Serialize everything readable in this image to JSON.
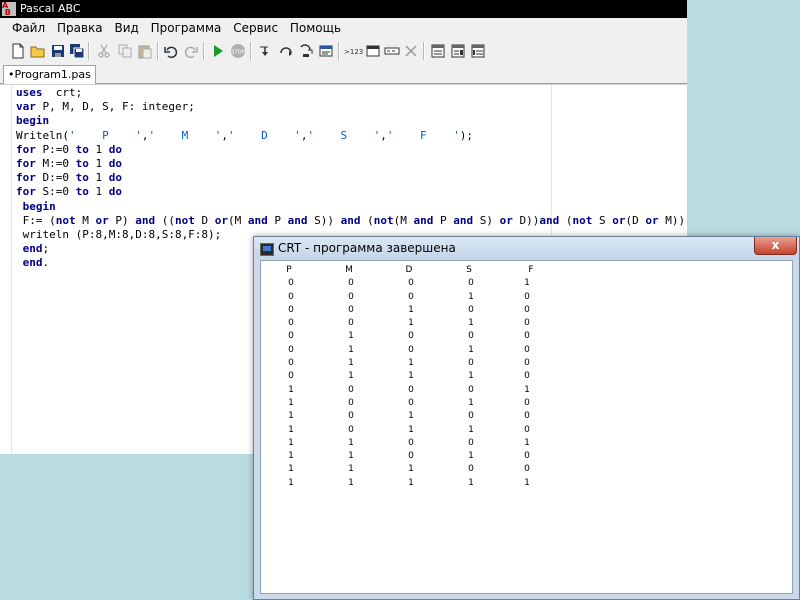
{
  "window": {
    "title": "Pascal ABC"
  },
  "menu": [
    "Файл",
    "Правка",
    "Вид",
    "Программа",
    "Сервис",
    "Помощь"
  ],
  "toolbar": [
    "new-file-icon",
    "open-folder-icon",
    "save-icon",
    "save-all-icon",
    "cut-icon",
    "copy-icon",
    "paste-icon",
    "undo-icon",
    "redo-icon",
    "run-icon",
    "stop-icon",
    "step-into-icon",
    "step-over-icon",
    "run-to-cursor-icon",
    "watch-icon",
    "format-code-icon",
    "window-icon",
    "output-icon",
    "close-icon",
    "debug-window-1-icon",
    "debug-window-2-icon",
    "debug-window-3-icon"
  ],
  "tab": {
    "label": "•Program1.pas"
  },
  "code_lines": [
    "uses  crt;",
    "var P, M, D, S, F: integer;",
    "begin",
    "Writeln('    P    ','    M    ','    D    ','    S    ','    F    ');",
    "for P:=0 to 1 do",
    "for M:=0 to 1 do",
    "for D:=0 to 1 do",
    "for S:=0 to 1 do",
    " begin",
    " F:= (not M or P) and ((not D or(M and P and S)) and (not(M and P and S) or D))and (not S or(D or M))",
    " writeln (P:8,M:8,D:8,S:8,F:8);",
    " end;",
    " end."
  ],
  "crt": {
    "title": "CRT - программа завершена",
    "close_label": "x",
    "headers": [
      "P",
      "M",
      "D",
      "S",
      "F"
    ],
    "rows": [
      [
        "0",
        "0",
        "0",
        "0",
        "1"
      ],
      [
        "0",
        "0",
        "0",
        "1",
        "0"
      ],
      [
        "0",
        "0",
        "1",
        "0",
        "0"
      ],
      [
        "0",
        "0",
        "1",
        "1",
        "0"
      ],
      [
        "0",
        "1",
        "0",
        "0",
        "0"
      ],
      [
        "0",
        "1",
        "0",
        "1",
        "0"
      ],
      [
        "0",
        "1",
        "1",
        "0",
        "0"
      ],
      [
        "0",
        "1",
        "1",
        "1",
        "0"
      ],
      [
        "1",
        "0",
        "0",
        "0",
        "1"
      ],
      [
        "1",
        "0",
        "0",
        "1",
        "0"
      ],
      [
        "1",
        "0",
        "1",
        "0",
        "0"
      ],
      [
        "1",
        "0",
        "1",
        "1",
        "0"
      ],
      [
        "1",
        "1",
        "0",
        "0",
        "1"
      ],
      [
        "1",
        "1",
        "0",
        "1",
        "0"
      ],
      [
        "1",
        "1",
        "1",
        "0",
        "0"
      ],
      [
        "1",
        "1",
        "1",
        "1",
        "1"
      ]
    ]
  },
  "colors": {
    "desktop": "#b9dce1",
    "keyword": "#000080",
    "string": "#0060c0",
    "crt_close": "#c7432c"
  }
}
